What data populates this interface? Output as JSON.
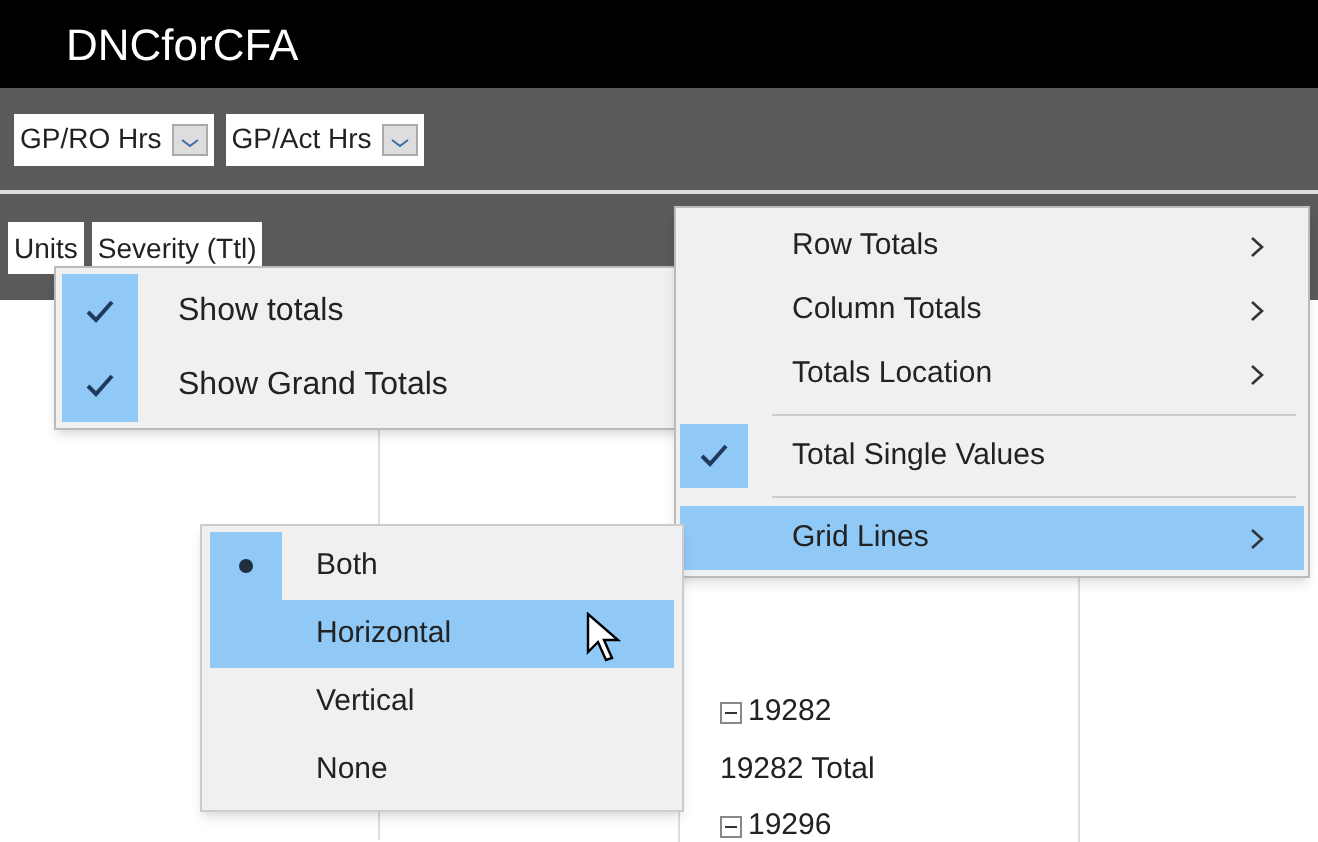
{
  "window": {
    "title": "DNCforCFA"
  },
  "filters": [
    {
      "label": "GP/RO Hrs"
    },
    {
      "label": "GP/Act Hrs"
    }
  ],
  "column_fields": [
    {
      "label": "Units"
    },
    {
      "label": "Severity (Ttl)"
    }
  ],
  "tree": [
    {
      "kind": "group",
      "label": "19282"
    },
    {
      "kind": "total",
      "label": "19282 Total"
    },
    {
      "kind": "group",
      "label": "19296"
    }
  ],
  "totals_menu": [
    {
      "label": "Show totals",
      "checked": true
    },
    {
      "label": "Show Grand Totals",
      "checked": true
    }
  ],
  "context_menu": [
    {
      "label": "Row Totals",
      "checked": false,
      "submenu": true,
      "hovered": false,
      "separator_before": false
    },
    {
      "label": "Column Totals",
      "checked": false,
      "submenu": true,
      "hovered": false,
      "separator_before": false
    },
    {
      "label": "Totals Location",
      "checked": false,
      "submenu": true,
      "hovered": false,
      "separator_before": false
    },
    {
      "label": "Total Single Values",
      "checked": true,
      "submenu": false,
      "hovered": false,
      "separator_before": true
    },
    {
      "label": "Grid Lines",
      "checked": false,
      "submenu": true,
      "hovered": true,
      "separator_before": true
    }
  ],
  "grid_lines_menu": [
    {
      "label": "Both",
      "selected": true,
      "hovered": false
    },
    {
      "label": "Horizontal",
      "selected": false,
      "hovered": true
    },
    {
      "label": "Vertical",
      "selected": false,
      "hovered": false
    },
    {
      "label": "None",
      "selected": false,
      "hovered": false
    }
  ]
}
